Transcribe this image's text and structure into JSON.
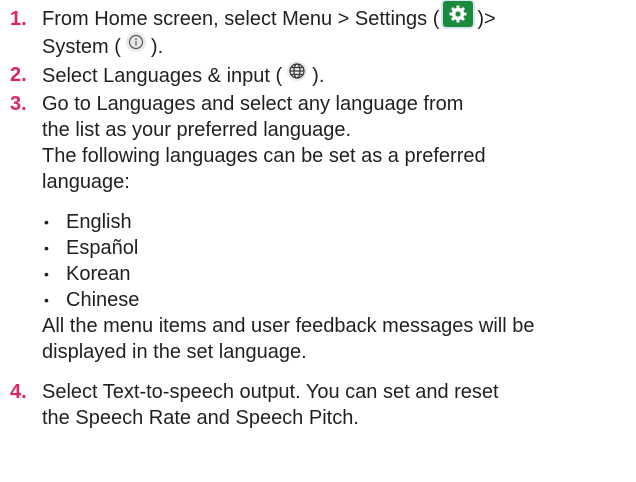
{
  "steps": [
    {
      "number": "1.",
      "line1_before": "From Home screen, select Menu > Settings (",
      "line1_after": ")>",
      "line2_before": "System (",
      "line2_after": ")."
    },
    {
      "number": "2.",
      "text_before": "Select Languages & input (",
      "text_after": ")."
    },
    {
      "number": "3.",
      "line1": "Go to Languages and select any language from",
      "line2": "the list as your preferred language.",
      "line3": "The following languages can be set as a preferred",
      "line4": "language:",
      "languages": [
        "English",
        "Español",
        "Korean",
        "Chinese"
      ],
      "note_line1": "All the menu items and user feedback messages will be",
      "note_line2": "displayed in the set language."
    },
    {
      "number": "4.",
      "line1": "Select Text-to-speech output. You can set and reset",
      "line2": "the Speech Rate and Speech Pitch."
    }
  ],
  "icons": {
    "settings": "settings-gear-icon",
    "system": "info-icon",
    "language": "globe-icon"
  },
  "colors": {
    "step_number": "#e0245e",
    "text": "#231f20",
    "settings_icon_bg": "#1a8a3c"
  }
}
